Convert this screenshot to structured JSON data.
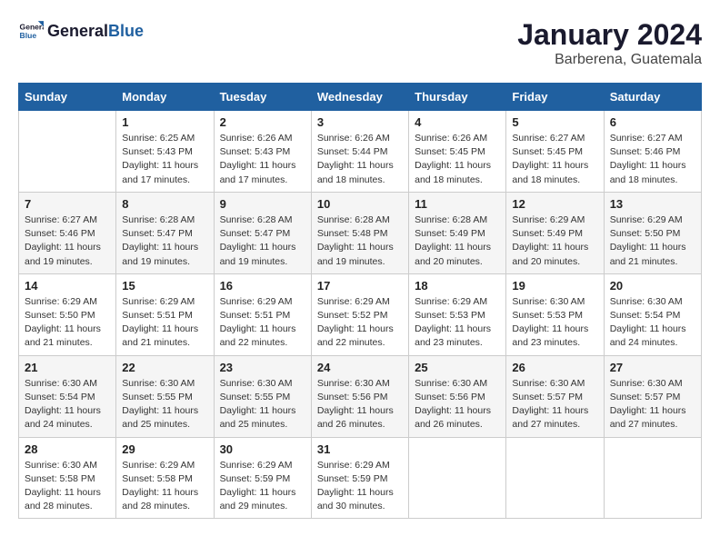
{
  "logo": {
    "general": "General",
    "blue": "Blue"
  },
  "header": {
    "month_title": "January 2024",
    "subtitle": "Barberena, Guatemala"
  },
  "days_of_week": [
    "Sunday",
    "Monday",
    "Tuesday",
    "Wednesday",
    "Thursday",
    "Friday",
    "Saturday"
  ],
  "weeks": [
    [
      {
        "day": "",
        "sunrise": "",
        "sunset": "",
        "daylight": ""
      },
      {
        "day": "1",
        "sunrise": "Sunrise: 6:25 AM",
        "sunset": "Sunset: 5:43 PM",
        "daylight": "Daylight: 11 hours and 17 minutes."
      },
      {
        "day": "2",
        "sunrise": "Sunrise: 6:26 AM",
        "sunset": "Sunset: 5:43 PM",
        "daylight": "Daylight: 11 hours and 17 minutes."
      },
      {
        "day": "3",
        "sunrise": "Sunrise: 6:26 AM",
        "sunset": "Sunset: 5:44 PM",
        "daylight": "Daylight: 11 hours and 18 minutes."
      },
      {
        "day": "4",
        "sunrise": "Sunrise: 6:26 AM",
        "sunset": "Sunset: 5:45 PM",
        "daylight": "Daylight: 11 hours and 18 minutes."
      },
      {
        "day": "5",
        "sunrise": "Sunrise: 6:27 AM",
        "sunset": "Sunset: 5:45 PM",
        "daylight": "Daylight: 11 hours and 18 minutes."
      },
      {
        "day": "6",
        "sunrise": "Sunrise: 6:27 AM",
        "sunset": "Sunset: 5:46 PM",
        "daylight": "Daylight: 11 hours and 18 minutes."
      }
    ],
    [
      {
        "day": "7",
        "sunrise": "Sunrise: 6:27 AM",
        "sunset": "Sunset: 5:46 PM",
        "daylight": "Daylight: 11 hours and 19 minutes."
      },
      {
        "day": "8",
        "sunrise": "Sunrise: 6:28 AM",
        "sunset": "Sunset: 5:47 PM",
        "daylight": "Daylight: 11 hours and 19 minutes."
      },
      {
        "day": "9",
        "sunrise": "Sunrise: 6:28 AM",
        "sunset": "Sunset: 5:47 PM",
        "daylight": "Daylight: 11 hours and 19 minutes."
      },
      {
        "day": "10",
        "sunrise": "Sunrise: 6:28 AM",
        "sunset": "Sunset: 5:48 PM",
        "daylight": "Daylight: 11 hours and 19 minutes."
      },
      {
        "day": "11",
        "sunrise": "Sunrise: 6:28 AM",
        "sunset": "Sunset: 5:49 PM",
        "daylight": "Daylight: 11 hours and 20 minutes."
      },
      {
        "day": "12",
        "sunrise": "Sunrise: 6:29 AM",
        "sunset": "Sunset: 5:49 PM",
        "daylight": "Daylight: 11 hours and 20 minutes."
      },
      {
        "day": "13",
        "sunrise": "Sunrise: 6:29 AM",
        "sunset": "Sunset: 5:50 PM",
        "daylight": "Daylight: 11 hours and 21 minutes."
      }
    ],
    [
      {
        "day": "14",
        "sunrise": "Sunrise: 6:29 AM",
        "sunset": "Sunset: 5:50 PM",
        "daylight": "Daylight: 11 hours and 21 minutes."
      },
      {
        "day": "15",
        "sunrise": "Sunrise: 6:29 AM",
        "sunset": "Sunset: 5:51 PM",
        "daylight": "Daylight: 11 hours and 21 minutes."
      },
      {
        "day": "16",
        "sunrise": "Sunrise: 6:29 AM",
        "sunset": "Sunset: 5:51 PM",
        "daylight": "Daylight: 11 hours and 22 minutes."
      },
      {
        "day": "17",
        "sunrise": "Sunrise: 6:29 AM",
        "sunset": "Sunset: 5:52 PM",
        "daylight": "Daylight: 11 hours and 22 minutes."
      },
      {
        "day": "18",
        "sunrise": "Sunrise: 6:29 AM",
        "sunset": "Sunset: 5:53 PM",
        "daylight": "Daylight: 11 hours and 23 minutes."
      },
      {
        "day": "19",
        "sunrise": "Sunrise: 6:30 AM",
        "sunset": "Sunset: 5:53 PM",
        "daylight": "Daylight: 11 hours and 23 minutes."
      },
      {
        "day": "20",
        "sunrise": "Sunrise: 6:30 AM",
        "sunset": "Sunset: 5:54 PM",
        "daylight": "Daylight: 11 hours and 24 minutes."
      }
    ],
    [
      {
        "day": "21",
        "sunrise": "Sunrise: 6:30 AM",
        "sunset": "Sunset: 5:54 PM",
        "daylight": "Daylight: 11 hours and 24 minutes."
      },
      {
        "day": "22",
        "sunrise": "Sunrise: 6:30 AM",
        "sunset": "Sunset: 5:55 PM",
        "daylight": "Daylight: 11 hours and 25 minutes."
      },
      {
        "day": "23",
        "sunrise": "Sunrise: 6:30 AM",
        "sunset": "Sunset: 5:55 PM",
        "daylight": "Daylight: 11 hours and 25 minutes."
      },
      {
        "day": "24",
        "sunrise": "Sunrise: 6:30 AM",
        "sunset": "Sunset: 5:56 PM",
        "daylight": "Daylight: 11 hours and 26 minutes."
      },
      {
        "day": "25",
        "sunrise": "Sunrise: 6:30 AM",
        "sunset": "Sunset: 5:56 PM",
        "daylight": "Daylight: 11 hours and 26 minutes."
      },
      {
        "day": "26",
        "sunrise": "Sunrise: 6:30 AM",
        "sunset": "Sunset: 5:57 PM",
        "daylight": "Daylight: 11 hours and 27 minutes."
      },
      {
        "day": "27",
        "sunrise": "Sunrise: 6:30 AM",
        "sunset": "Sunset: 5:57 PM",
        "daylight": "Daylight: 11 hours and 27 minutes."
      }
    ],
    [
      {
        "day": "28",
        "sunrise": "Sunrise: 6:30 AM",
        "sunset": "Sunset: 5:58 PM",
        "daylight": "Daylight: 11 hours and 28 minutes."
      },
      {
        "day": "29",
        "sunrise": "Sunrise: 6:29 AM",
        "sunset": "Sunset: 5:58 PM",
        "daylight": "Daylight: 11 hours and 28 minutes."
      },
      {
        "day": "30",
        "sunrise": "Sunrise: 6:29 AM",
        "sunset": "Sunset: 5:59 PM",
        "daylight": "Daylight: 11 hours and 29 minutes."
      },
      {
        "day": "31",
        "sunrise": "Sunrise: 6:29 AM",
        "sunset": "Sunset: 5:59 PM",
        "daylight": "Daylight: 11 hours and 30 minutes."
      },
      {
        "day": "",
        "sunrise": "",
        "sunset": "",
        "daylight": ""
      },
      {
        "day": "",
        "sunrise": "",
        "sunset": "",
        "daylight": ""
      },
      {
        "day": "",
        "sunrise": "",
        "sunset": "",
        "daylight": ""
      }
    ]
  ]
}
